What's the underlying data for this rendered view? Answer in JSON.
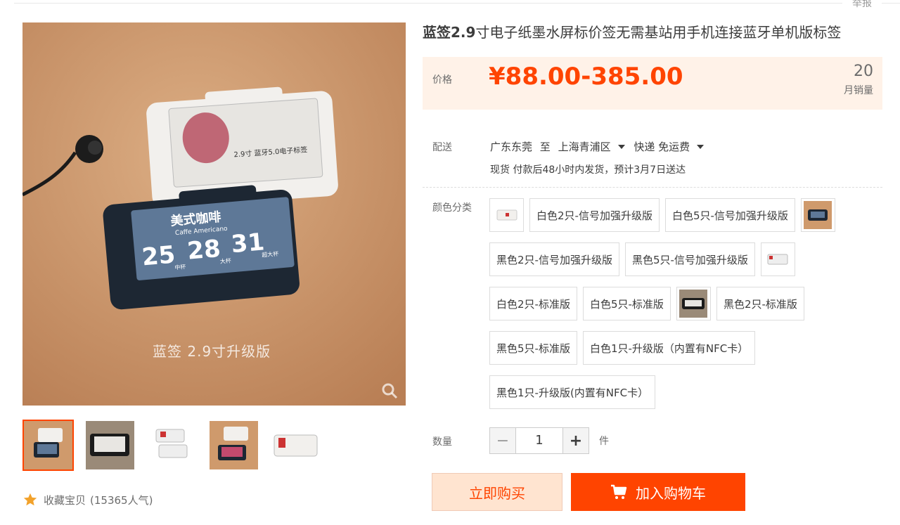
{
  "report": "举报",
  "product": {
    "title_bold": "蓝签2.9",
    "title_rest": "寸电子纸墨水屏标价签无需基站用手机连接蓝牙单机版标签",
    "image_caption": "蓝签 2.9寸升级版",
    "device_white_text": "2.9寸 蓝牙5.0电子标签",
    "device_black_title": "美式咖啡",
    "device_black_sub": "Caffe Americano",
    "device_black_prices": [
      "25",
      "28",
      "31"
    ],
    "device_black_sizes": [
      "中杯",
      "大杯",
      "超大杯"
    ]
  },
  "price": {
    "label": "价格",
    "value": "¥88.00-385.00",
    "sales_count": "20",
    "sales_label": "月销量"
  },
  "delivery": {
    "label": "配送",
    "from": "广东东莞",
    "to_word": "至",
    "to": "上海青浦区",
    "method": "快递 免运费",
    "note": "现货 付款后48小时内发货，预计3月7日送达"
  },
  "sku": {
    "label": "颜色分类",
    "options": [
      "白色2只-信号加强升级版",
      "白色5只-信号加强升级版",
      "黑色2只-信号加强升级版",
      "黑色5只-信号加强升级版",
      "白色2只-标准版",
      "白色5只-标准版",
      "黑色2只-标准版",
      "黑色5只-标准版",
      "白色1只-升级版（内置有NFC卡）",
      "黑色1只-升级版(内置有NFC卡）"
    ]
  },
  "quantity": {
    "label": "数量",
    "minus": "−",
    "value": "1",
    "plus": "+",
    "unit": "件"
  },
  "actions": {
    "buy_now": "立即购买",
    "add_cart": "加入购物车"
  },
  "favorite": {
    "label": "收藏宝贝",
    "count": "(15365人气)"
  },
  "colors": {
    "accent": "#ff4400",
    "price_bg": "#fff2e8",
    "buy_now_bg": "#ffe4d0"
  }
}
